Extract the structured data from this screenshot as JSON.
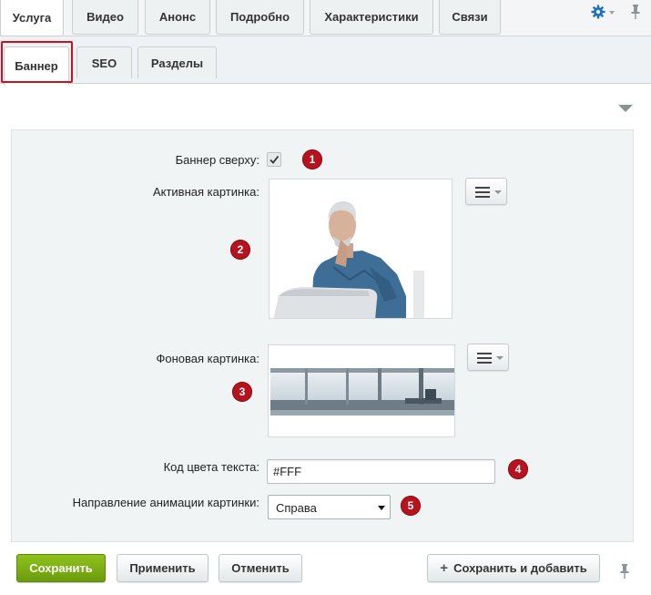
{
  "tabs_top": [
    {
      "label": "Услуга",
      "active": true
    },
    {
      "label": "Видео",
      "active": false
    },
    {
      "label": "Анонс",
      "active": false
    },
    {
      "label": "Подробно",
      "active": false
    },
    {
      "label": "Характеристики",
      "active": false
    },
    {
      "label": "Связи",
      "active": false
    }
  ],
  "tabs_sub": [
    {
      "label": "Баннер",
      "active": true
    },
    {
      "label": "SEO",
      "active": false
    },
    {
      "label": "Разделы",
      "active": false
    }
  ],
  "form": {
    "banner_top_label": "Баннер сверху:",
    "banner_top_checked": true,
    "active_image_label": "Активная картинка:",
    "bg_image_label": "Фоновая картинка:",
    "text_color_label": "Код цвета текста:",
    "text_color_value": "#FFF",
    "anim_dir_label": "Направление анимации картинки:",
    "anim_dir_value": "Справа"
  },
  "badges": [
    "1",
    "2",
    "3",
    "4",
    "5"
  ],
  "buttons": {
    "save": "Сохранить",
    "apply": "Применить",
    "cancel": "Отменить",
    "save_add": "Сохранить и добавить"
  },
  "icons": {
    "settings": "gear-icon",
    "pin": "pin-icon",
    "collapse": "triangle-down-icon",
    "menu": "hamburger-menu-icon",
    "add": "plus-icon"
  },
  "colors": {
    "accent_green": "#7bb015",
    "badge_red": "#b5141f",
    "highlight_red": "#c9121e",
    "gear_blue": "#1f6fb5"
  }
}
